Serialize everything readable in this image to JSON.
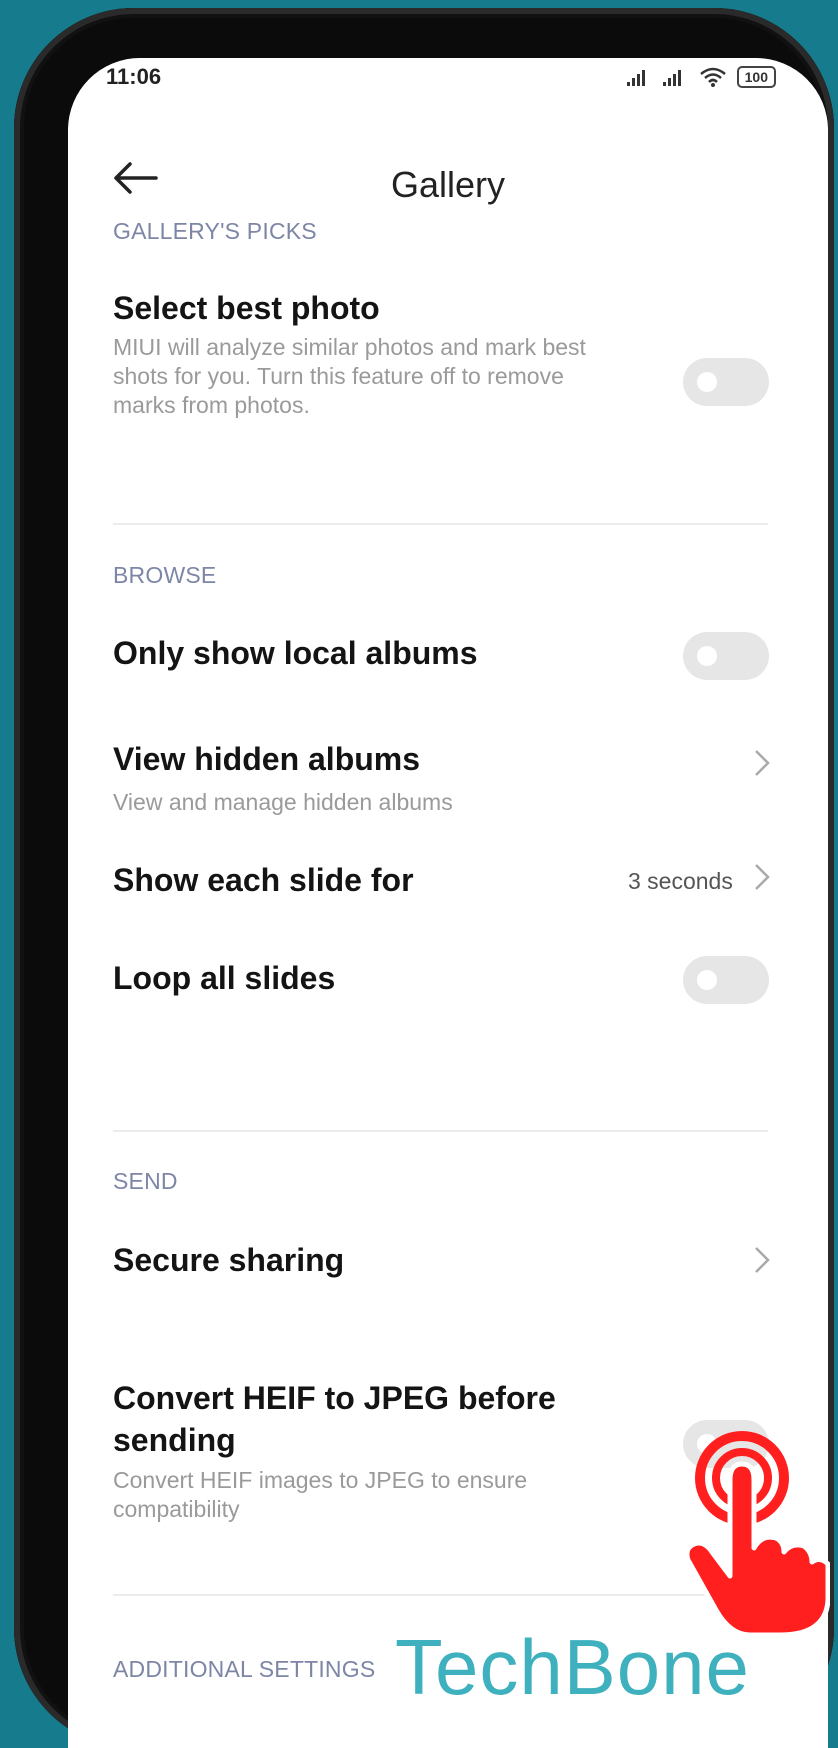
{
  "status_bar": {
    "time": "11:06",
    "battery": "100"
  },
  "header": {
    "title": "Gallery"
  },
  "sections": {
    "picks": {
      "label": "GALLERY'S PICKS",
      "select_best": {
        "title": "Select best photo",
        "subtitle_l1": "MIUI will analyze similar photos and mark best",
        "subtitle_l2": "shots for you. Turn this feature off to remove",
        "subtitle_l3": "marks from photos.",
        "enabled": false
      }
    },
    "browse": {
      "label": "BROWSE",
      "local_albums": {
        "title": "Only show local albums",
        "enabled": false
      },
      "hidden_albums": {
        "title": "View hidden albums",
        "subtitle": "View and manage hidden albums"
      },
      "slide_duration": {
        "title": "Show each slide for",
        "value": "3 seconds"
      },
      "loop_slides": {
        "title": "Loop all slides",
        "enabled": false
      }
    },
    "send": {
      "label": "SEND",
      "secure_sharing": {
        "title": "Secure sharing"
      },
      "convert_heif": {
        "title_l1": "Convert HEIF to JPEG before",
        "title_l2": "sending",
        "subtitle_l1": "Convert HEIF images to JPEG to ensure",
        "subtitle_l2": "compatibility",
        "enabled": false
      }
    },
    "additional": {
      "label": "ADDITIONAL SETTINGS"
    }
  },
  "watermark": "TechBone",
  "colors": {
    "background": "#167b8c",
    "section_label": "#7e86a6",
    "toggle_off": "#e6e6e6",
    "tap_indicator": "#ff1f1f"
  }
}
